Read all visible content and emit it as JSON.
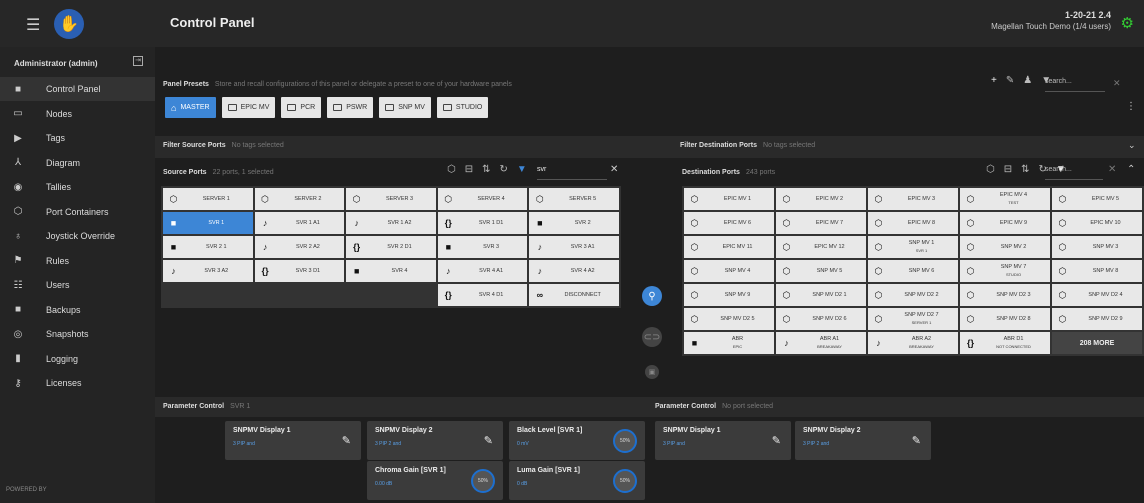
{
  "topbar": {
    "title": "Control Panel",
    "version": "1-20-21 2.4",
    "user_info": "Magellan Touch Demo (1/4 users)"
  },
  "sidebar": {
    "admin": "Administrator (admin)",
    "powered": "POWERED BY",
    "items": [
      {
        "label": "Control Panel",
        "icon": "control-panel-icon",
        "glyph": "■"
      },
      {
        "label": "Nodes",
        "icon": "nodes-icon",
        "glyph": "▭"
      },
      {
        "label": "Tags",
        "icon": "tag-icon",
        "glyph": "▶"
      },
      {
        "label": "Diagram",
        "icon": "diagram-icon",
        "glyph": "⅄"
      },
      {
        "label": "Tallies",
        "icon": "tallies-icon",
        "glyph": "◉"
      },
      {
        "label": "Port Containers",
        "icon": "port-containers-icon",
        "glyph": "⬡"
      },
      {
        "label": "Joystick Override",
        "icon": "joystick-icon",
        "glyph": "♁"
      },
      {
        "label": "Rules",
        "icon": "rules-icon",
        "glyph": "⚑"
      },
      {
        "label": "Users",
        "icon": "users-icon",
        "glyph": "☷"
      },
      {
        "label": "Backups",
        "icon": "backups-icon",
        "glyph": "■"
      },
      {
        "label": "Snapshots",
        "icon": "snapshots-icon",
        "glyph": "◎"
      },
      {
        "label": "Logging",
        "icon": "logging-icon",
        "glyph": "▮"
      },
      {
        "label": "Licenses",
        "icon": "key-icon",
        "glyph": "⚷"
      }
    ]
  },
  "presets": {
    "title": "Panel Presets",
    "desc": "Store and recall configurations of this panel or delegate a preset to one of your hardware panels",
    "search_placeholder": "search...",
    "buttons": [
      "MASTER",
      "EPIC MV",
      "PCR",
      "PSWR",
      "SNP MV",
      "STUDIO"
    ]
  },
  "filter_source": {
    "title": "Filter Source Ports",
    "note": "No tags selected"
  },
  "filter_dest": {
    "title": "Filter Destination Ports",
    "note": "No tags selected"
  },
  "source": {
    "title": "Source Ports",
    "count": "22 ports, 1 selected",
    "search_value": "svr",
    "ports": [
      [
        "SERVER 1",
        "SERVER 2",
        "SERVER 3",
        "SERVER 4",
        "SERVER 5"
      ],
      [
        "SVR 1",
        "SVR 1 A1",
        "SVR 1 A2",
        "SVR 1 D1",
        "SVR 2"
      ],
      [
        "SVR 2 1",
        "SVR 2 A2",
        "SVR 2 D1",
        "SVR 3",
        "SVR 3 A1"
      ],
      [
        "SVR 3 A2",
        "SVR 3 D1",
        "SVR 4",
        "SVR 4 A1",
        "SVR 4 A2"
      ],
      [
        "",
        "",
        "",
        "SVR 4 D1",
        "DISCONNECT"
      ]
    ]
  },
  "dest": {
    "title": "Destination Ports",
    "count": "243 ports",
    "search_placeholder": "search...",
    "more": "208 MORE",
    "ports": [
      [
        "EPIC MV 1",
        "EPIC MV 2",
        "EPIC MV 3",
        "EPIC MV 4",
        "EPIC MV 5"
      ],
      [
        "EPIC MV 6",
        "EPIC MV 7",
        "EPIC MV 8",
        "EPIC MV 9",
        "EPIC MV 10"
      ],
      [
        "EPIC MV 11",
        "EPIC MV 12",
        "SNP MV 1",
        "SNP MV 2",
        "SNP MV 3"
      ],
      [
        "SNP MV 4",
        "SNP MV 5",
        "SNP MV 6",
        "SNP MV 7",
        "SNP MV 8"
      ],
      [
        "SNP MV 9",
        "SNP MV D2 1",
        "SNP MV D2 2",
        "SNP MV D2 3",
        "SNP MV D2 4"
      ],
      [
        "SNP MV D2 5",
        "SNP MV D2 6",
        "SNP MV D2 7",
        "SNP MV D2 8",
        "SNP MV D2 9"
      ],
      [
        "ABR",
        "ABR A1",
        "ABR A2",
        "ABR D1",
        ""
      ]
    ],
    "subs": {
      "EPIC MV 4": "TEST",
      "SNP MV 1": "SVR 1",
      "SNP MV 7": "STUDIO",
      "SNP MV D2 7": "SERVER 1",
      "ABR": "EPIC",
      "ABR A1": "BREAKAWAY",
      "ABR A2": "BREAKAWAY",
      "ABR D1": "NOT CONNECTED"
    }
  },
  "param_left": {
    "title": "Parameter Control",
    "subtitle": "SVR 1",
    "cards": [
      {
        "title": "SNPMV Display 1",
        "value": "3 PIP and",
        "type": "pen"
      },
      {
        "title": "SNPMV Display 2",
        "value": "3 PIP 2 and",
        "type": "pen"
      },
      {
        "title": "Black Level [SVR 1]",
        "value": "0 mV",
        "type": "knob",
        "knob": "50%"
      },
      {
        "title": "Chroma Gain [SVR 1]",
        "value": "0.00 dB",
        "type": "knob",
        "knob": "50%"
      },
      {
        "title": "Luma Gain [SVR 1]",
        "value": "0 dB",
        "type": "knob",
        "knob": "50%"
      }
    ]
  },
  "param_right": {
    "title": "Parameter Control",
    "subtitle": "No port selected",
    "cards": [
      {
        "title": "SNPMV Display 1",
        "value": "3 PIP and",
        "type": "pen"
      },
      {
        "title": "SNPMV Display 2",
        "value": "3 PIP 2 and",
        "type": "pen"
      }
    ]
  },
  "colors": {
    "accent": "#3d86d6",
    "topbar": "#272727",
    "sidebar": "#242424",
    "brand_green": "#33cc33"
  }
}
